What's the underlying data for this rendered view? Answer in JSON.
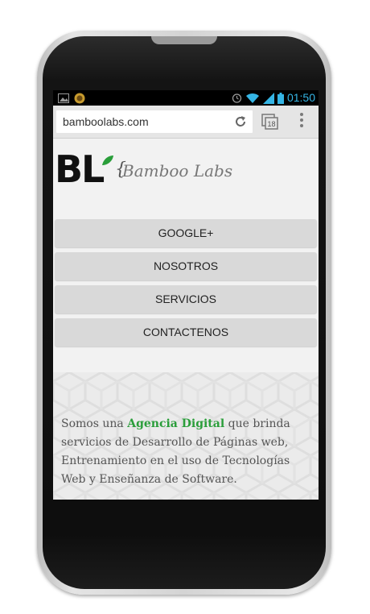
{
  "status_bar": {
    "time": "01:50",
    "icons": [
      "photo-icon",
      "cat-app-icon",
      "alarm-icon",
      "wifi-icon",
      "signal-icon",
      "battery-icon"
    ]
  },
  "browser": {
    "url": "bamboolabs.com",
    "tab_count": "18"
  },
  "logo": {
    "monogram": "BL",
    "brace": "{",
    "name": "Bamboo Labs"
  },
  "nav": {
    "items": [
      {
        "label": "GOOGLE+"
      },
      {
        "label": "NOSOTROS"
      },
      {
        "label": "SERVICIOS"
      },
      {
        "label": "CONTACTENOS"
      }
    ]
  },
  "intro": {
    "before": "Somos una ",
    "highlight": "Agencia Digital",
    "after": " que brinda servicios de Desarrollo de Páginas web, Entrenamiento en el uso de Tecnologías Web y Enseñanza de Software."
  },
  "colors": {
    "accent_green": "#2a9e3a",
    "status_blue": "#35b5e5"
  }
}
